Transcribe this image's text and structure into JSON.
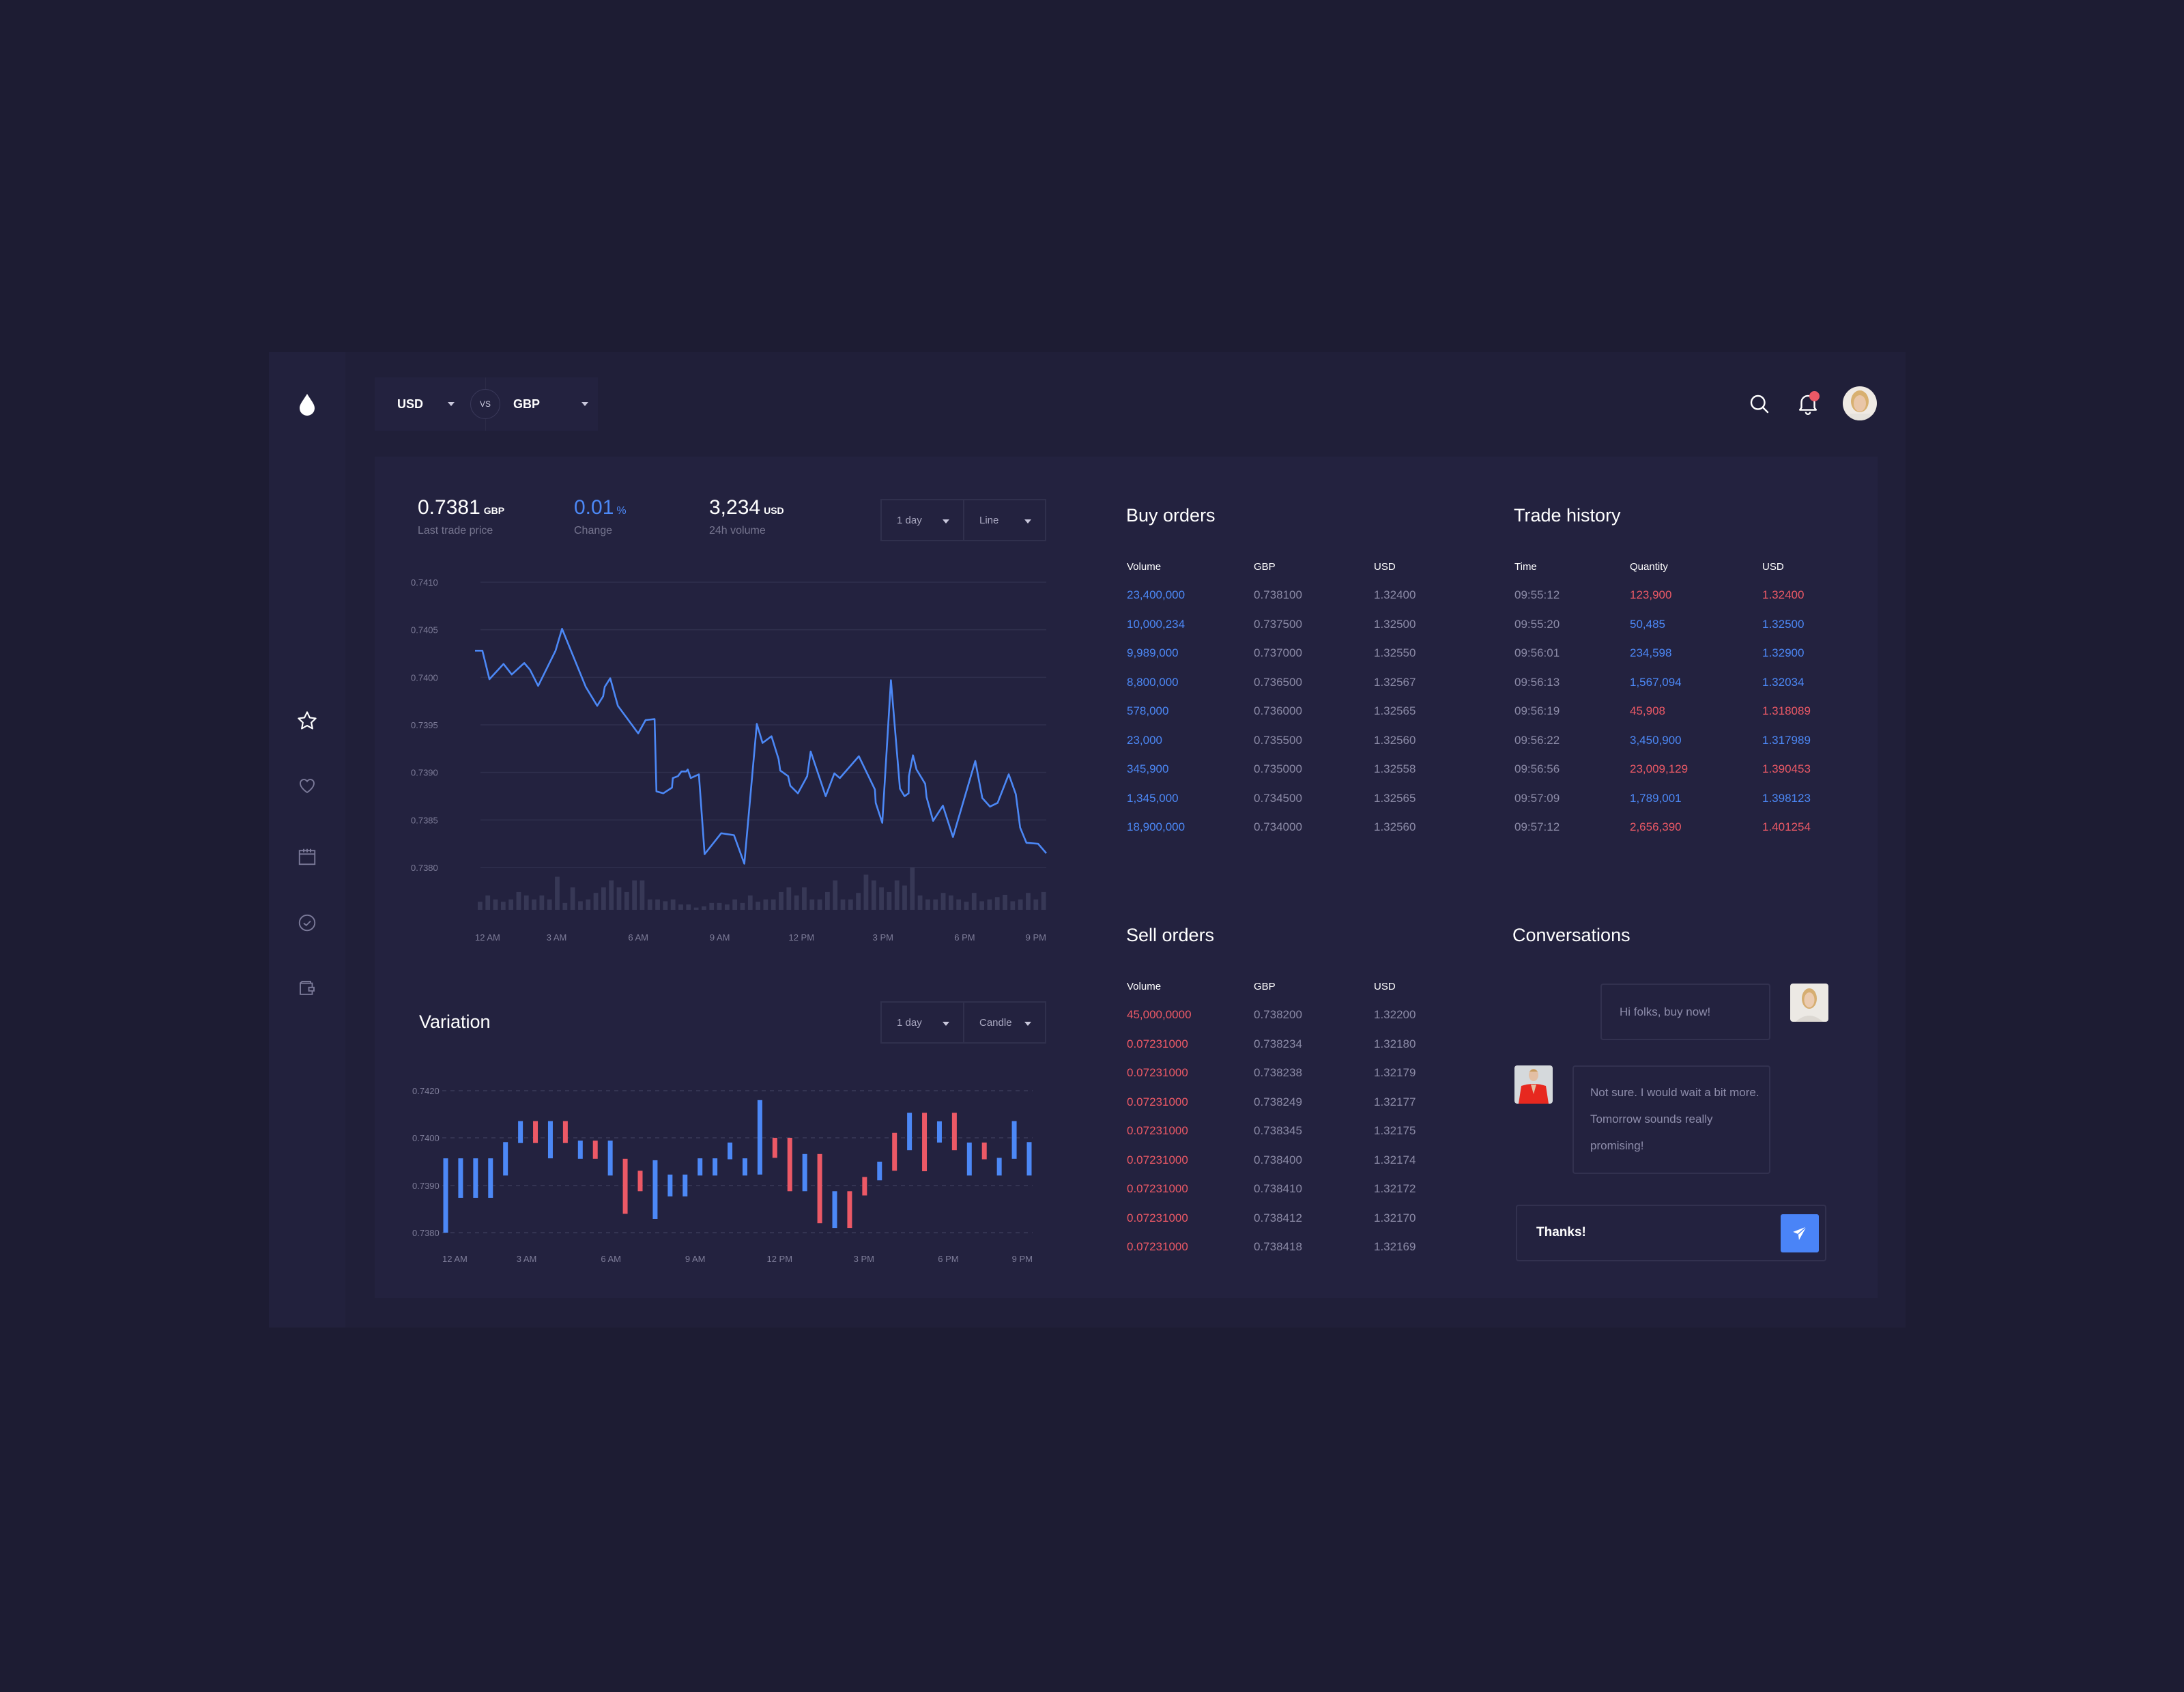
{
  "header": {
    "base_currency": "USD",
    "vs_label": "VS",
    "quote_currency": "GBP",
    "icons": [
      "search-icon",
      "bell-icon",
      "user-avatar"
    ],
    "notification_dot": true
  },
  "sidebar": {
    "logo_icon": "drop-icon",
    "items": [
      {
        "icon": "star-icon",
        "active": true
      },
      {
        "icon": "heart-icon",
        "active": false
      },
      {
        "icon": "calendar-icon",
        "active": false
      },
      {
        "icon": "check-circle-icon",
        "active": false
      },
      {
        "icon": "wallet-icon",
        "active": false
      }
    ]
  },
  "stats": {
    "last_price": "0.7381",
    "last_price_unit": "GBP",
    "last_price_label": "Last trade price",
    "change": "0.01",
    "change_unit": "%",
    "change_label": "Change",
    "volume": "3,234",
    "volume_unit": "USD",
    "volume_label": "24h volume"
  },
  "price_chart_controls": {
    "period": "1 day",
    "type": "Line"
  },
  "variation": {
    "title": "Variation",
    "period": "1 day",
    "type": "Candle"
  },
  "colors": {
    "accent_blue": "#4c88f6",
    "accent_red": "#ec5966",
    "panel": "#23223f",
    "background": "#1d1c33"
  },
  "chart_data": [
    {
      "type": "line",
      "title": "",
      "x_ticks": [
        "12 AM",
        "3 AM",
        "6 AM",
        "9 AM",
        "12 PM",
        "3 PM",
        "6 PM",
        "9 PM"
      ],
      "y_ticks": [
        "0.7410",
        "0.7405",
        "0.7400",
        "0.7395",
        "0.7390",
        "0.7385",
        "0.7380"
      ],
      "xlim_hours": [
        0,
        21
      ],
      "ylim": [
        0.738,
        0.741
      ],
      "grid": true,
      "series": [
        {
          "x": [
            0,
            0.27,
            0.53,
            1.05,
            1.35,
            1.81,
            2.02,
            2.32,
            2.96,
            3.2,
            4.07,
            4.49,
            4.71,
            4.77,
            4.97,
            5.25,
            6.0,
            6.27,
            6.6,
            6.67,
            6.92,
            7.24,
            7.27,
            7.46,
            7.59,
            7.76,
            7.82,
            7.93,
            8.23,
            8.44,
            9.05,
            9.52,
            9.9,
            10.36,
            10.57,
            10.9,
            11.16,
            11.22,
            11.51,
            11.59,
            11.87,
            12.21,
            12.34,
            12.89,
            13.21,
            13.41,
            14.11,
            14.7,
            14.73,
            14.97,
            15.29,
            15.62,
            15.79,
            15.94,
            15.95,
            16.1,
            16.23,
            16.55,
            16.6,
            16.84,
            17.2,
            17.57,
            18.39,
            18.65,
            18.93,
            19.21,
            19.62,
            19.88,
            20.04,
            20.27,
            20.7,
            21.0
          ],
          "y": [
            0.74028,
            0.74028,
            0.73998,
            0.74014,
            0.74003,
            0.74015,
            0.74008,
            0.73991,
            0.74028,
            0.74051,
            0.7399,
            0.7397,
            0.7398,
            0.7399,
            0.73999,
            0.7397,
            0.73941,
            0.73955,
            0.73956,
            0.7388,
            0.73878,
            0.73884,
            0.73894,
            0.73896,
            0.73901,
            0.73901,
            0.73903,
            0.73894,
            0.73898,
            0.73814,
            0.73836,
            0.73834,
            0.73804,
            0.73951,
            0.73931,
            0.73938,
            0.73914,
            0.73902,
            0.73896,
            0.73886,
            0.73878,
            0.73896,
            0.73922,
            0.73875,
            0.73899,
            0.73894,
            0.73917,
            0.73882,
            0.73868,
            0.73847,
            0.73997,
            0.73883,
            0.73875,
            0.73878,
            0.73896,
            0.73918,
            0.73903,
            0.73888,
            0.73874,
            0.73849,
            0.73865,
            0.73832,
            0.73912,
            0.73873,
            0.73864,
            0.73868,
            0.73898,
            0.73877,
            0.73842,
            0.73826,
            0.73825,
            0.73815
          ]
        }
      ],
      "volume_bars_relative": [
        35,
        62,
        45,
        35,
        45,
        77,
        62,
        45,
        62,
        45,
        143,
        30,
        97,
        37,
        45,
        73,
        97,
        127,
        97,
        77,
        127,
        127,
        45,
        45,
        37,
        45,
        23,
        23,
        10,
        15,
        30,
        30,
        23,
        45,
        30,
        62,
        35,
        45,
        45,
        77,
        97,
        62,
        97,
        45,
        45,
        77,
        127,
        45,
        45,
        73,
        152,
        127,
        97,
        77,
        127,
        105,
        183,
        62,
        45,
        45,
        73,
        62,
        45,
        35,
        73,
        37,
        45,
        55,
        65,
        37,
        45,
        73,
        45,
        77
      ]
    },
    {
      "type": "candlestick",
      "title": "Variation",
      "x_ticks": [
        "12 AM",
        "3 AM",
        "6 AM",
        "9 AM",
        "12 PM",
        "3 PM",
        "6 PM",
        "9 PM"
      ],
      "y_ticks": [
        "0.7420",
        "0.7400",
        "0.7390",
        "0.7380"
      ],
      "grid": "dashed",
      "candles": [
        {
          "high": 0.73957,
          "low": 0.738,
          "dir": "up"
        },
        {
          "high": 0.73957,
          "low": 0.73874,
          "dir": "up"
        },
        {
          "high": 0.73957,
          "low": 0.73874,
          "dir": "up"
        },
        {
          "high": 0.73957,
          "low": 0.73874,
          "dir": "up"
        },
        {
          "high": 0.73991,
          "low": 0.73921,
          "dir": "up"
        },
        {
          "high": 0.74071,
          "low": 0.73989,
          "dir": "up"
        },
        {
          "high": 0.74071,
          "low": 0.73989,
          "dir": "down"
        },
        {
          "high": 0.74071,
          "low": 0.73957,
          "dir": "up"
        },
        {
          "high": 0.74071,
          "low": 0.73989,
          "dir": "down"
        },
        {
          "high": 0.73994,
          "low": 0.73956,
          "dir": "up"
        },
        {
          "high": 0.73994,
          "low": 0.73956,
          "dir": "down"
        },
        {
          "high": 0.73994,
          "low": 0.73921,
          "dir": "up"
        },
        {
          "high": 0.73956,
          "low": 0.7384,
          "dir": "down"
        },
        {
          "high": 0.73931,
          "low": 0.73888,
          "dir": "down"
        },
        {
          "high": 0.73953,
          "low": 0.73829,
          "dir": "up"
        },
        {
          "high": 0.73923,
          "low": 0.73877,
          "dir": "up"
        },
        {
          "high": 0.73923,
          "low": 0.73877,
          "dir": "up"
        },
        {
          "high": 0.73957,
          "low": 0.73921,
          "dir": "up"
        },
        {
          "high": 0.73957,
          "low": 0.73921,
          "dir": "up"
        },
        {
          "high": 0.7399,
          "low": 0.73955,
          "dir": "up"
        },
        {
          "high": 0.73957,
          "low": 0.73921,
          "dir": "up"
        },
        {
          "high": 0.7416,
          "low": 0.73923,
          "dir": "up"
        },
        {
          "high": 0.74,
          "low": 0.73958,
          "dir": "down"
        },
        {
          "high": 0.74,
          "low": 0.73888,
          "dir": "down"
        },
        {
          "high": 0.73966,
          "low": 0.73888,
          "dir": "up"
        },
        {
          "high": 0.73966,
          "low": 0.7382,
          "dir": "down"
        },
        {
          "high": 0.73888,
          "low": 0.7381,
          "dir": "up"
        },
        {
          "high": 0.73888,
          "low": 0.7381,
          "dir": "down"
        },
        {
          "high": 0.73918,
          "low": 0.73879,
          "dir": "down"
        },
        {
          "high": 0.7395,
          "low": 0.73911,
          "dir": "up"
        },
        {
          "high": 0.74021,
          "low": 0.73931,
          "dir": "down"
        },
        {
          "high": 0.74106,
          "low": 0.73974,
          "dir": "up"
        },
        {
          "high": 0.74106,
          "low": 0.7393,
          "dir": "down"
        },
        {
          "high": 0.7407,
          "low": 0.7399,
          "dir": "up"
        },
        {
          "high": 0.74106,
          "low": 0.73974,
          "dir": "down"
        },
        {
          "high": 0.7399,
          "low": 0.73921,
          "dir": "up"
        },
        {
          "high": 0.7399,
          "low": 0.73955,
          "dir": "down"
        },
        {
          "high": 0.73958,
          "low": 0.73921,
          "dir": "up"
        },
        {
          "high": 0.74071,
          "low": 0.73956,
          "dir": "up"
        },
        {
          "high": 0.73991,
          "low": 0.73921,
          "dir": "up"
        }
      ]
    }
  ],
  "buy_orders": {
    "title": "Buy orders",
    "columns": [
      "Volume",
      "GBP",
      "USD"
    ],
    "rows": [
      [
        "23,400,000",
        "0.738100",
        "1.32400"
      ],
      [
        "10,000,234",
        "0.737500",
        "1.32500"
      ],
      [
        "9,989,000",
        "0.737000",
        "1.32550"
      ],
      [
        "8,800,000",
        "0.736500",
        "1.32567"
      ],
      [
        "578,000",
        "0.736000",
        "1.32565"
      ],
      [
        "23,000",
        "0.735500",
        "1.32560"
      ],
      [
        "345,900",
        "0.735000",
        "1.32558"
      ],
      [
        "1,345,000",
        "0.734500",
        "1.32565"
      ],
      [
        "18,900,000",
        "0.734000",
        "1.32560"
      ]
    ]
  },
  "trade_history": {
    "title": "Trade history",
    "columns": [
      "Time",
      "Quantity",
      "USD"
    ],
    "rows": [
      {
        "cells": [
          "09:55:12",
          "123,900",
          "1.32400"
        ],
        "side": "red"
      },
      {
        "cells": [
          "09:55:20",
          "50,485",
          "1.32500"
        ],
        "side": "blue"
      },
      {
        "cells": [
          "09:56:01",
          "234,598",
          "1.32900"
        ],
        "side": "blue"
      },
      {
        "cells": [
          "09:56:13",
          "1,567,094",
          "1.32034"
        ],
        "side": "blue"
      },
      {
        "cells": [
          "09:56:19",
          "45,908",
          "1.318089"
        ],
        "side": "red"
      },
      {
        "cells": [
          "09:56:22",
          "3,450,900",
          "1.317989"
        ],
        "side": "blue"
      },
      {
        "cells": [
          "09:56:56",
          "23,009,129",
          "1.390453"
        ],
        "side": "red"
      },
      {
        "cells": [
          "09:57:09",
          "1,789,001",
          "1.398123"
        ],
        "side": "blue"
      },
      {
        "cells": [
          "09:57:12",
          "2,656,390",
          "1.401254"
        ],
        "side": "red"
      }
    ]
  },
  "sell_orders": {
    "title": "Sell orders",
    "columns": [
      "Volume",
      "GBP",
      "USD"
    ],
    "rows": [
      [
        "45,000,0000",
        "0.738200",
        "1.32200"
      ],
      [
        "0.07231000",
        "0.738234",
        "1.32180"
      ],
      [
        "0.07231000",
        "0.738238",
        "1.32179"
      ],
      [
        "0.07231000",
        "0.738249",
        "1.32177"
      ],
      [
        "0.07231000",
        "0.738345",
        "1.32175"
      ],
      [
        "0.07231000",
        "0.738400",
        "1.32174"
      ],
      [
        "0.07231000",
        "0.738410",
        "1.32172"
      ],
      [
        "0.07231000",
        "0.738412",
        "1.32170"
      ],
      [
        "0.07231000",
        "0.738418",
        "1.32169"
      ]
    ]
  },
  "conversations": {
    "title": "Conversations",
    "messages": [
      {
        "text": "Hi folks, buy now!",
        "side": "right"
      },
      {
        "text": "Not sure. I would wait a bit more. Tomorrow sounds really promising!",
        "side": "left"
      }
    ],
    "input_value": "Thanks!",
    "send_icon": "paper-plane-icon"
  }
}
